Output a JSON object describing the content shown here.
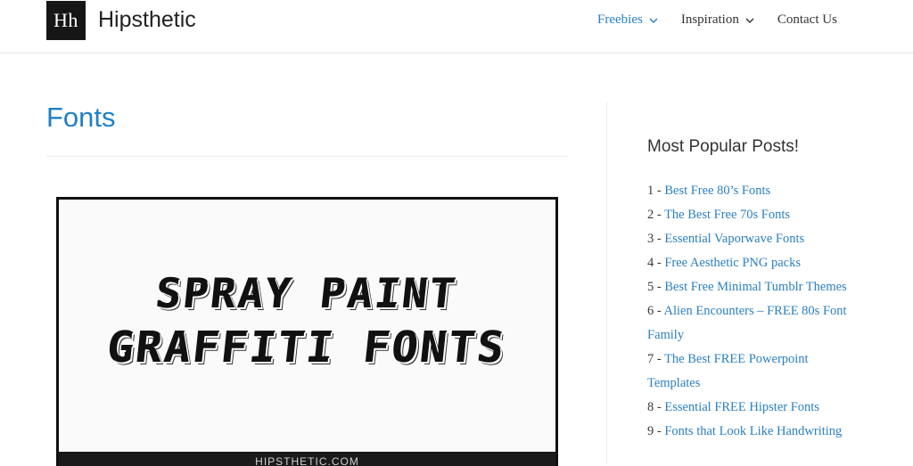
{
  "header": {
    "logo_text": "Hh",
    "site_title": "Hipsthetic",
    "nav": [
      {
        "label": "Freebies",
        "active": true,
        "has_dropdown": true
      },
      {
        "label": "Inspiration",
        "active": false,
        "has_dropdown": true
      },
      {
        "label": "Contact Us",
        "active": false,
        "has_dropdown": false
      }
    ]
  },
  "main": {
    "page_title": "Fonts",
    "featured": {
      "line1": "SPRAY PAINT",
      "line2": "GRAFFITI FONTS",
      "footer": "HIPSTHETIC.COM"
    }
  },
  "sidebar": {
    "widget_title": "Most Popular Posts!",
    "posts": [
      {
        "num": "1 - ",
        "title": "Best Free 80’s Fonts"
      },
      {
        "num": "2 - ",
        "title": "The Best Free 70s Fonts"
      },
      {
        "num": "3 - ",
        "title": "Essential Vaporwave Fonts"
      },
      {
        "num": "4 - ",
        "title": "Free Aesthetic PNG packs"
      },
      {
        "num": "5 - ",
        "title": "Best Free Minimal Tumblr Themes"
      },
      {
        "num": "6 - ",
        "title": "Alien Encounters – FREE 80s Font Family"
      },
      {
        "num": "7 - ",
        "title": "The Best FREE Powerpoint Templates"
      },
      {
        "num": "8 - ",
        "title": "Essential FREE Hipster Fonts"
      },
      {
        "num": "9 - ",
        "title": "Fonts that Look Like Handwriting"
      }
    ]
  },
  "colors": {
    "link": "#2b7fc1",
    "title": "#1f7fc4",
    "logo_bg": "#161616"
  }
}
